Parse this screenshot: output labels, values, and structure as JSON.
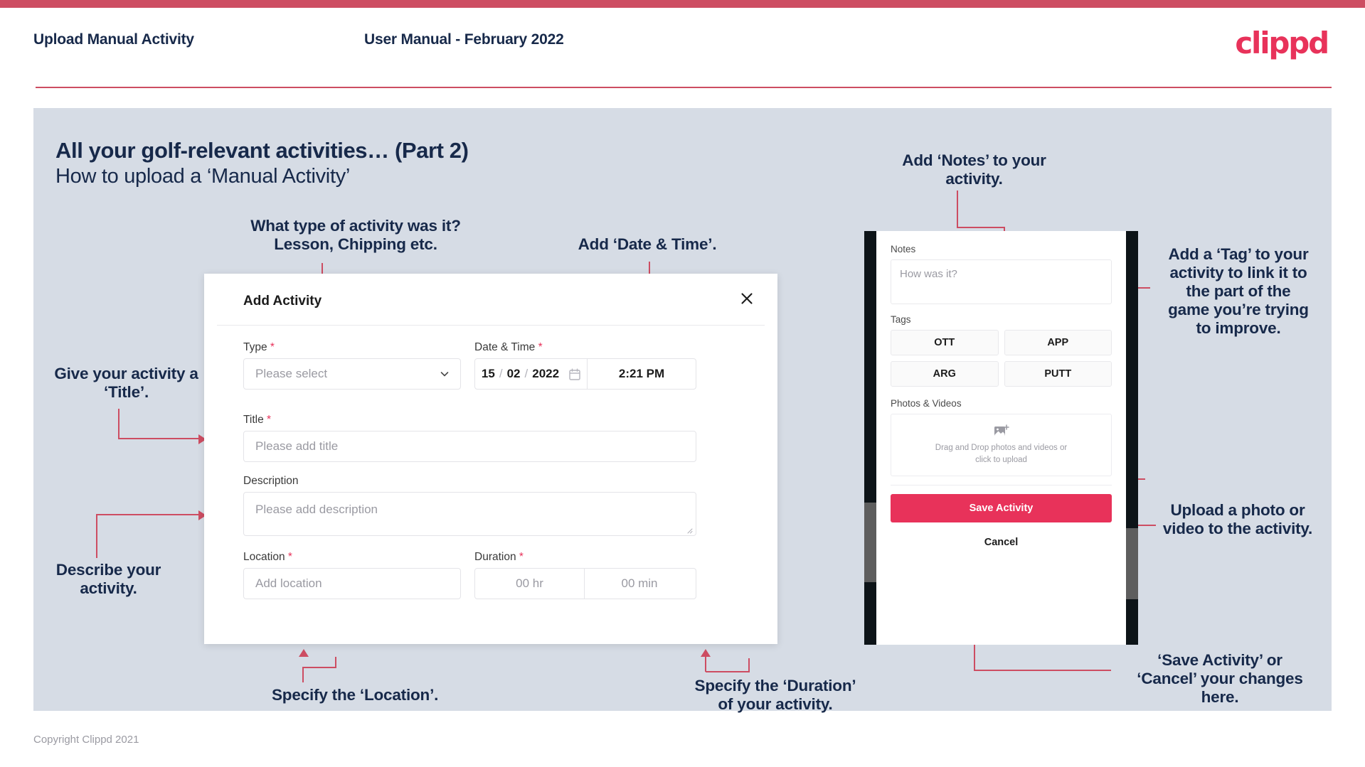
{
  "header": {
    "title": "Upload Manual Activity",
    "subtitle": "User Manual - February 2022",
    "logo": "clippd"
  },
  "slide": {
    "title": "All your golf-relevant activities… (Part 2)",
    "subtitle": "How to upload a ‘Manual Activity’"
  },
  "annotations": {
    "type": "What type of activity was it?\nLesson, Chipping etc.",
    "date_time": "Add ‘Date & Time’.",
    "title_field": "Give your activity a\n‘Title’.",
    "description": "Describe your\nactivity.",
    "location": "Specify the ‘Location’.",
    "duration": "Specify the ‘Duration’\nof your activity.",
    "notes": "Add ‘Notes’ to your\nactivity.",
    "tags": "Add a ‘Tag’ to your\nactivity to link it to\nthe part of the\ngame you’re trying\nto improve.",
    "photos": "Upload a photo or\nvideo to the activity.",
    "save_cancel": "‘Save Activity’ or\n‘Cancel’ your changes\nhere."
  },
  "dialog": {
    "title": "Add Activity",
    "close_icon": "close-icon",
    "fields": {
      "type": {
        "label": "Type",
        "required": "*",
        "placeholder": "Please select",
        "chevron_icon": "chevron-down-icon"
      },
      "date_time": {
        "label": "Date & Time",
        "required": "*",
        "day": "15",
        "month": "02",
        "year": "2022",
        "separator": "/",
        "time": "2:21 PM",
        "calendar_icon": "calendar-icon"
      },
      "title": {
        "label": "Title",
        "required": "*",
        "placeholder": "Please add title"
      },
      "description": {
        "label": "Description",
        "required": "",
        "placeholder": "Please add description"
      },
      "location": {
        "label": "Location",
        "required": "*",
        "placeholder": "Add location"
      },
      "duration": {
        "label": "Duration",
        "required": "*",
        "hours_placeholder": "00 hr",
        "minutes_placeholder": "00 min"
      }
    }
  },
  "phone": {
    "notes": {
      "label": "Notes",
      "placeholder": "How was it?"
    },
    "tags": {
      "label": "Tags",
      "items": [
        "OTT",
        "APP",
        "ARG",
        "PUTT"
      ]
    },
    "photos": {
      "label": "Photos & Videos",
      "dropzone_line1": "Drag and Drop photos and videos or",
      "dropzone_line2": "click to upload",
      "upload_icon": "add-image-icon"
    },
    "save_label": "Save Activity",
    "cancel_label": "Cancel"
  },
  "footer": {
    "copyright": "Copyright Clippd 2021"
  },
  "colors": {
    "accent_pink": "#e8325a",
    "bar_pink": "#cd4d62",
    "slide_bg": "#d6dce5",
    "navy_text": "#17294a"
  }
}
